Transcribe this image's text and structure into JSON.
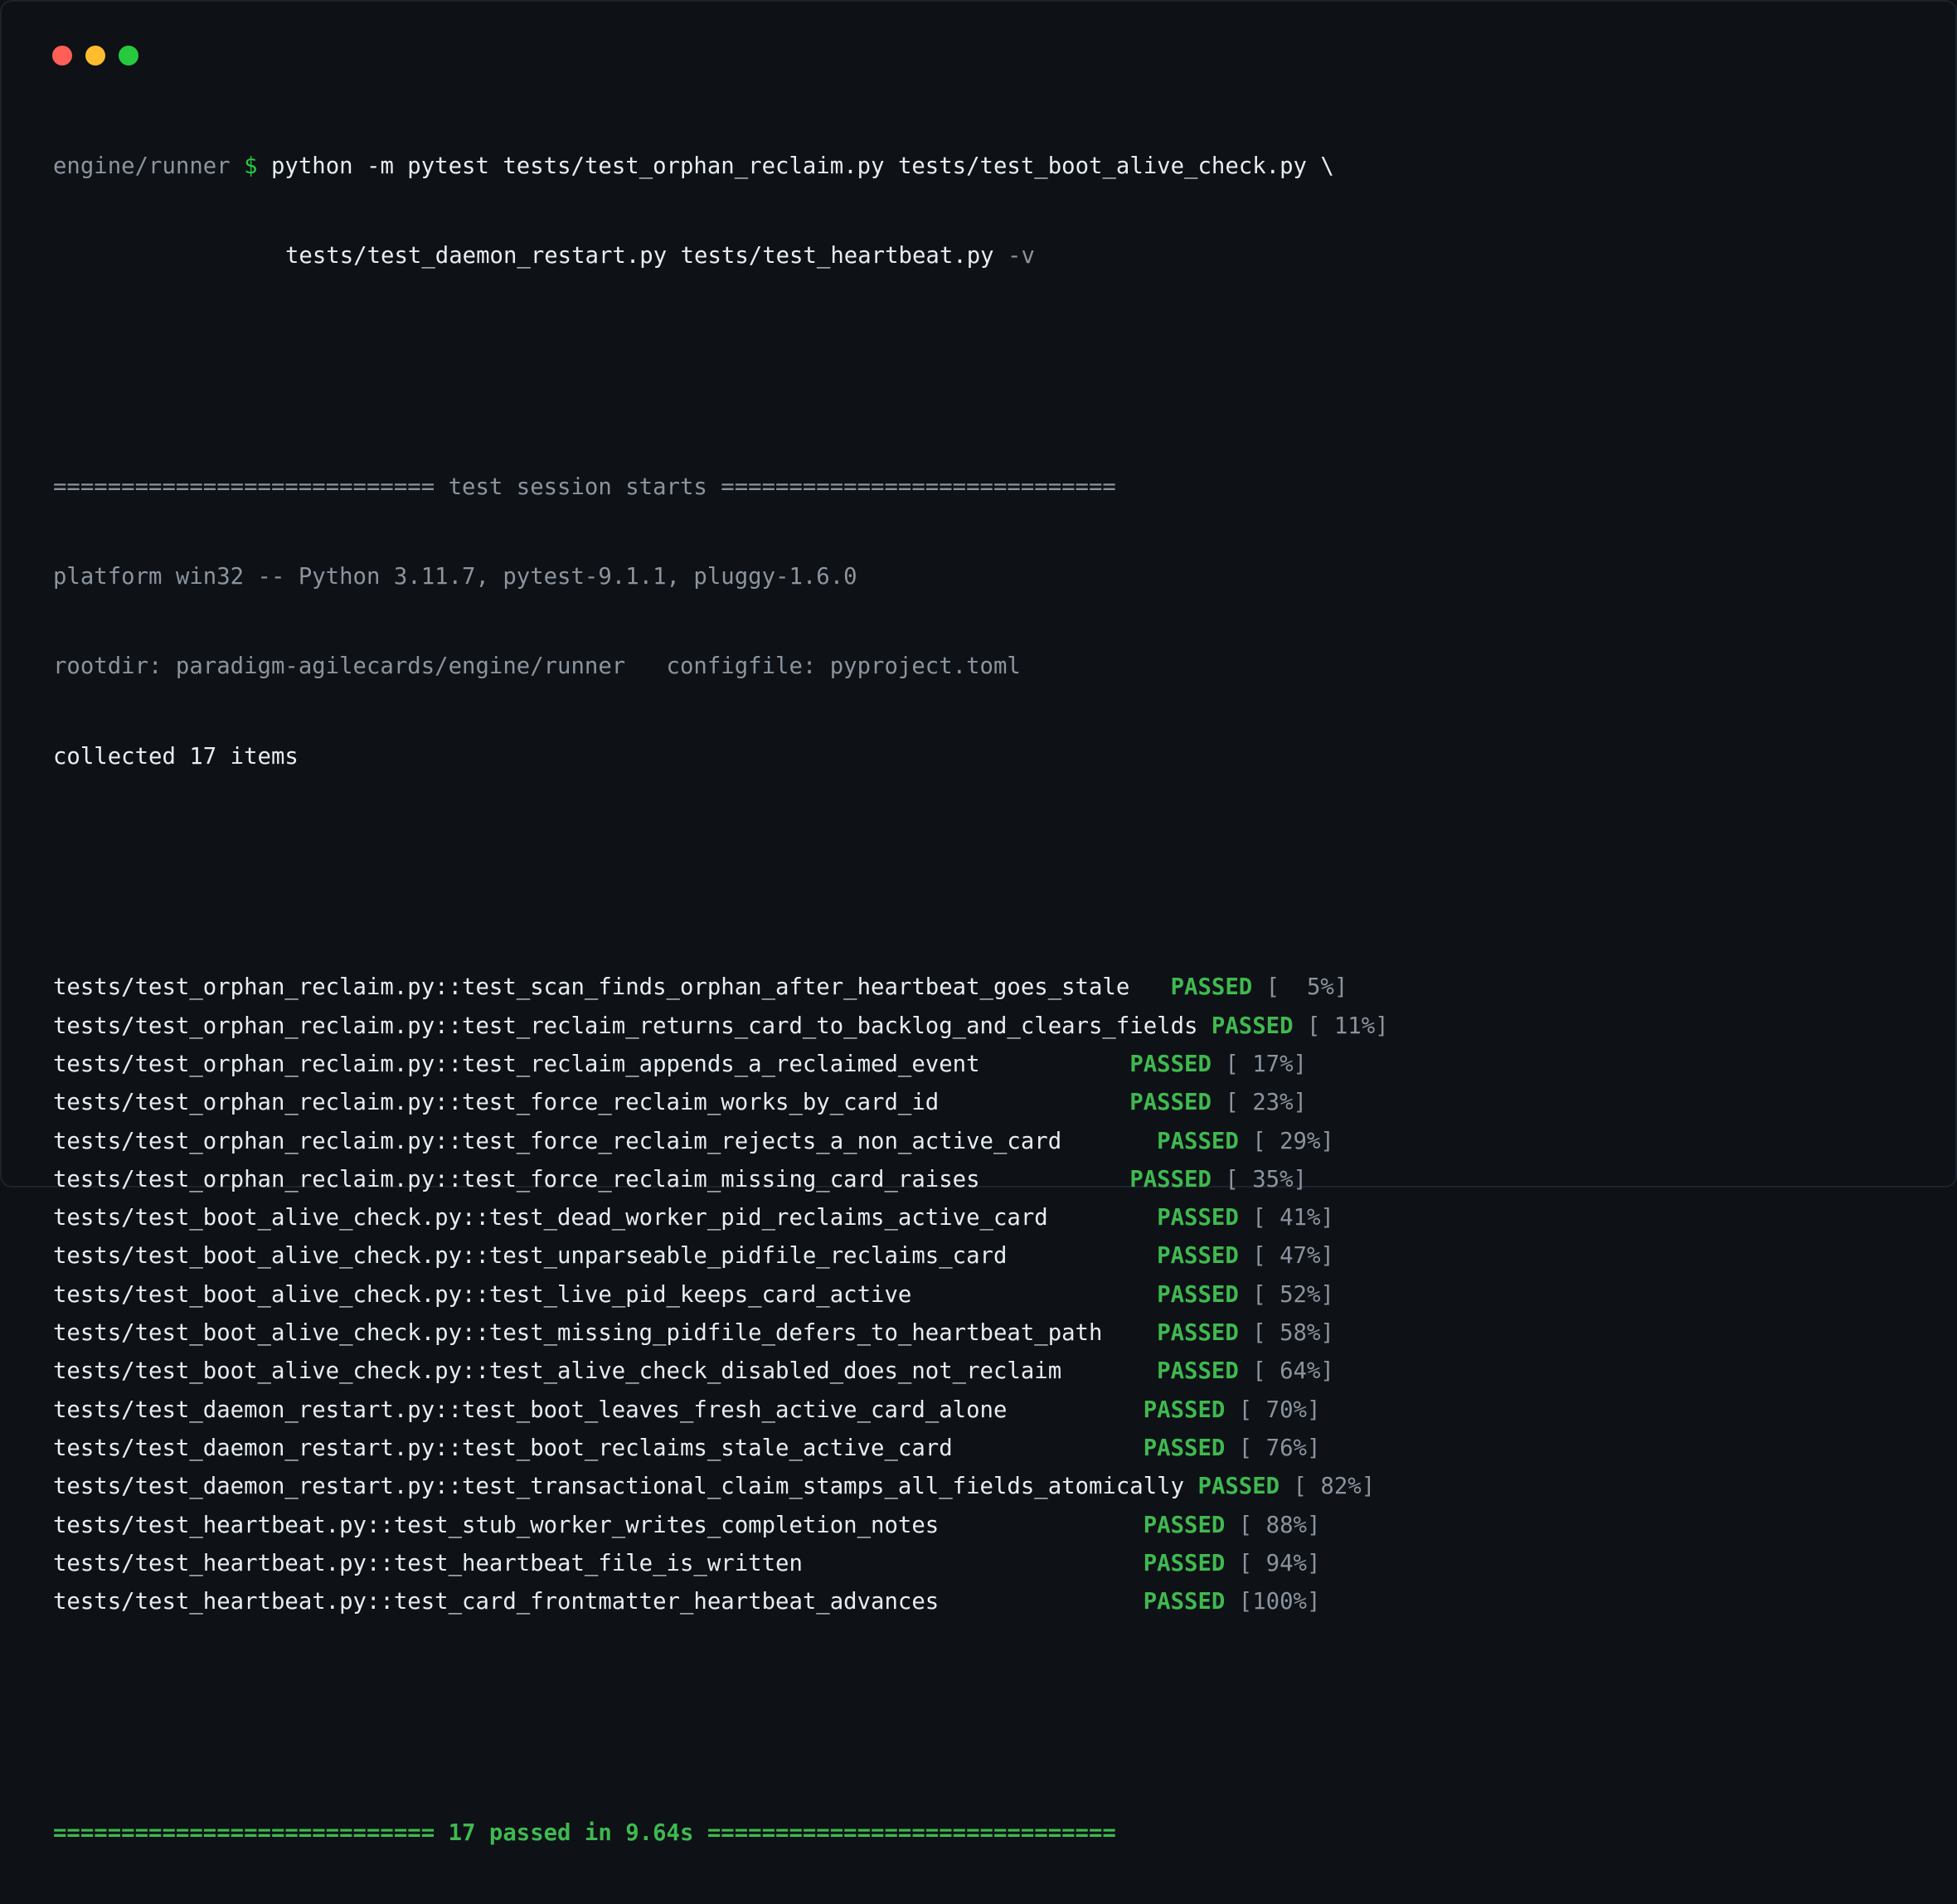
{
  "window": {
    "buttons": [
      "close",
      "minimize",
      "maximize"
    ],
    "colors": {
      "close": "#ff5f56",
      "minimize": "#ffbd2e",
      "maximize": "#27c93f"
    }
  },
  "command": {
    "cwd": "engine/runner",
    "prompt": "$",
    "line1": "python -m pytest tests/test_orphan_reclaim.py tests/test_boot_alive_check.py \\",
    "line2": "tests/test_daemon_restart.py tests/test_heartbeat.py",
    "flag": "-v"
  },
  "session": {
    "header": "============================ test session starts =============================",
    "platform": "platform win32 -- Python 3.11.7, pytest-9.1.1, pluggy-1.6.0",
    "rootdir": "rootdir: paradigm-agilecards/engine/runner   configfile: pyproject.toml",
    "collected": "collected 17 items"
  },
  "tests": [
    {
      "name": "tests/test_orphan_reclaim.py::test_scan_finds_orphan_after_heartbeat_goes_stale",
      "pad": "   ",
      "status": "PASSED",
      "progress": "[  5%]"
    },
    {
      "name": "tests/test_orphan_reclaim.py::test_reclaim_returns_card_to_backlog_and_clears_fields",
      "pad": " ",
      "status": "PASSED",
      "progress": "[ 11%]"
    },
    {
      "name": "tests/test_orphan_reclaim.py::test_reclaim_appends_a_reclaimed_event",
      "pad": "           ",
      "status": "PASSED",
      "progress": "[ 17%]"
    },
    {
      "name": "tests/test_orphan_reclaim.py::test_force_reclaim_works_by_card_id",
      "pad": "              ",
      "status": "PASSED",
      "progress": "[ 23%]"
    },
    {
      "name": "tests/test_orphan_reclaim.py::test_force_reclaim_rejects_a_non_active_card",
      "pad": "       ",
      "status": "PASSED",
      "progress": "[ 29%]"
    },
    {
      "name": "tests/test_orphan_reclaim.py::test_force_reclaim_missing_card_raises",
      "pad": "           ",
      "status": "PASSED",
      "progress": "[ 35%]"
    },
    {
      "name": "tests/test_boot_alive_check.py::test_dead_worker_pid_reclaims_active_card",
      "pad": "        ",
      "status": "PASSED",
      "progress": "[ 41%]"
    },
    {
      "name": "tests/test_boot_alive_check.py::test_unparseable_pidfile_reclaims_card",
      "pad": "           ",
      "status": "PASSED",
      "progress": "[ 47%]"
    },
    {
      "name": "tests/test_boot_alive_check.py::test_live_pid_keeps_card_active",
      "pad": "                  ",
      "status": "PASSED",
      "progress": "[ 52%]"
    },
    {
      "name": "tests/test_boot_alive_check.py::test_missing_pidfile_defers_to_heartbeat_path",
      "pad": "    ",
      "status": "PASSED",
      "progress": "[ 58%]"
    },
    {
      "name": "tests/test_boot_alive_check.py::test_alive_check_disabled_does_not_reclaim",
      "pad": "       ",
      "status": "PASSED",
      "progress": "[ 64%]"
    },
    {
      "name": "tests/test_daemon_restart.py::test_boot_leaves_fresh_active_card_alone",
      "pad": "          ",
      "status": "PASSED",
      "progress": "[ 70%]"
    },
    {
      "name": "tests/test_daemon_restart.py::test_boot_reclaims_stale_active_card",
      "pad": "              ",
      "status": "PASSED",
      "progress": "[ 76%]"
    },
    {
      "name": "tests/test_daemon_restart.py::test_transactional_claim_stamps_all_fields_atomically",
      "pad": " ",
      "status": "PASSED",
      "progress": "[ 82%]"
    },
    {
      "name": "tests/test_heartbeat.py::test_stub_worker_writes_completion_notes",
      "pad": "               ",
      "status": "PASSED",
      "progress": "[ 88%]"
    },
    {
      "name": "tests/test_heartbeat.py::test_heartbeat_file_is_written",
      "pad": "                         ",
      "status": "PASSED",
      "progress": "[ 94%]"
    },
    {
      "name": "tests/test_heartbeat.py::test_card_frontmatter_heartbeat_advances",
      "pad": "               ",
      "status": "PASSED",
      "progress": "[100%]"
    }
  ],
  "summary": "============================ 17 passed in 9.64s =============================="
}
